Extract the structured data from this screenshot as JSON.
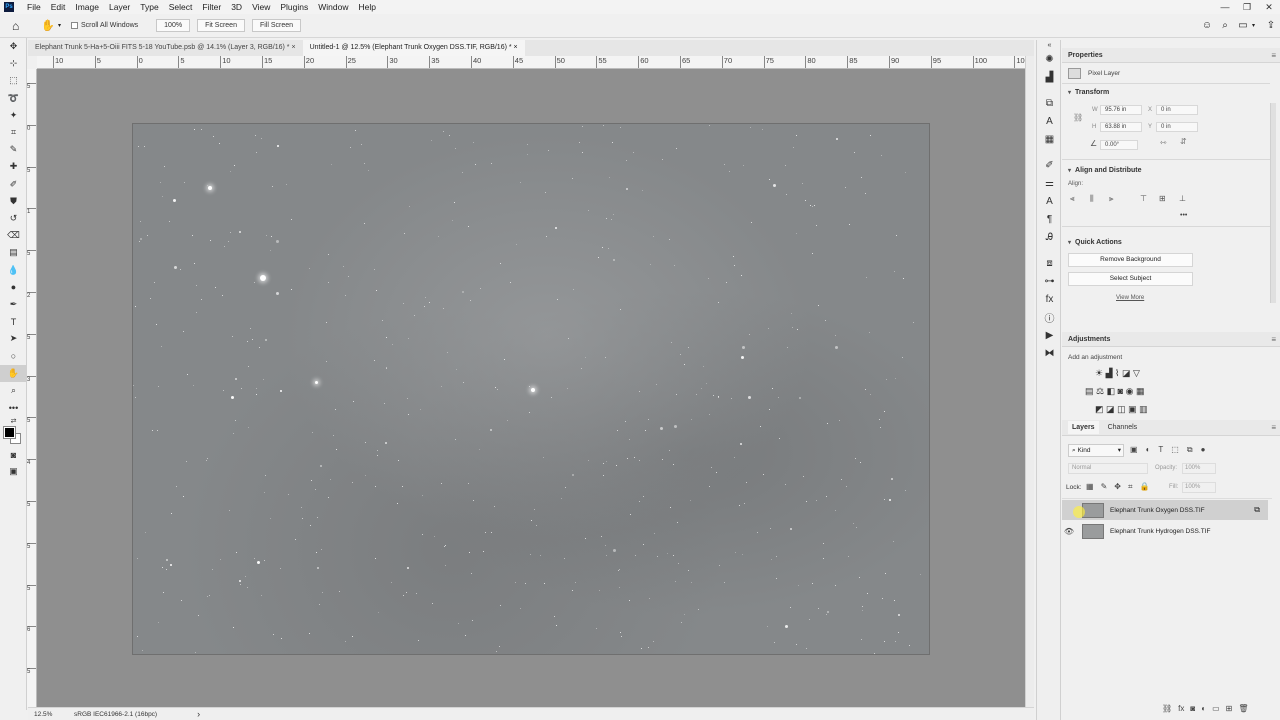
{
  "app": {
    "logo": "Ps"
  },
  "menu": [
    "File",
    "Edit",
    "Image",
    "Layer",
    "Type",
    "Select",
    "Filter",
    "3D",
    "View",
    "Plugins",
    "Window",
    "Help"
  ],
  "window_controls": {
    "minimize": "—",
    "restore": "❐",
    "close": "✕"
  },
  "options_bar": {
    "scroll_all_windows": "Scroll All Windows",
    "zoom_btn": "100%",
    "fit_screen": "Fit Screen",
    "fill_screen": "Fill Screen"
  },
  "tabs": [
    {
      "label": "Elephant Trunk 5-Ha+5-Oiii FITS 5-18 YouTube.psb @ 14.1% (Layer 3, RGB/16) *",
      "close": "×"
    },
    {
      "label": "Untitled-1 @ 12.5% (Elephant Trunk Oxygen DSS.TIF, RGB/16) *",
      "close": "×"
    }
  ],
  "ruler_h": [
    "10",
    "5",
    "0",
    "5",
    "10",
    "15",
    "20",
    "25",
    "30",
    "35",
    "40",
    "45",
    "50",
    "55",
    "60",
    "65",
    "70",
    "75",
    "80",
    "85",
    "90",
    "95",
    "100",
    "105"
  ],
  "ruler_v": [
    "5",
    "0",
    "5",
    "1",
    "5",
    "2",
    "5",
    "3",
    "5",
    "4",
    "5",
    "5",
    "5",
    "6",
    "5"
  ],
  "status": {
    "zoom": "12.5%",
    "profile": "sRGB IEC61966-2.1 (16bpc)",
    "arrow": "›"
  },
  "properties": {
    "title": "Properties",
    "pixel_layer": "Pixel Layer",
    "transform": "Transform",
    "w_label": "W",
    "w_value": "95.76 in",
    "h_label": "H",
    "h_value": "63.88 in",
    "x_label": "X",
    "x_value": "0 in",
    "y_label": "Y",
    "y_value": "0 in",
    "angle": "0.00°",
    "align_distribute": "Align and Distribute",
    "align_label": "Align:",
    "more": "•••",
    "quick_actions": "Quick Actions",
    "remove_background": "Remove Background",
    "select_subject": "Select Subject",
    "view_more": "View More"
  },
  "adjustments": {
    "title": "Adjustments",
    "add": "Add an adjustment"
  },
  "layers": {
    "tab_layers": "Layers",
    "tab_channels": "Channels",
    "kind": "Kind",
    "blend_mode": "Normal",
    "opacity_label": "Opacity:",
    "opacity": "100%",
    "lock_label": "Lock:",
    "fill_label": "Fill:",
    "fill": "100%",
    "items": [
      {
        "name": "Elephant Trunk Oxygen DSS.TIF",
        "selected": true
      },
      {
        "name": "Elephant Trunk Hydrogen DSS.TIF",
        "selected": false
      }
    ]
  },
  "tool_icons": [
    "move-icon",
    "artboard-icon",
    "marquee-icon",
    "lasso-icon",
    "object-select-icon",
    "crop-icon",
    "eyedropper-icon",
    "healing-icon",
    "brush-icon",
    "stamp-icon",
    "history-brush-icon",
    "eraser-icon",
    "gradient-icon",
    "blur-icon",
    "dodge-icon",
    "pen-icon",
    "type-icon",
    "path-select-icon",
    "shape-icon",
    "hand-icon",
    "zoom-icon",
    "more-tools-icon"
  ]
}
